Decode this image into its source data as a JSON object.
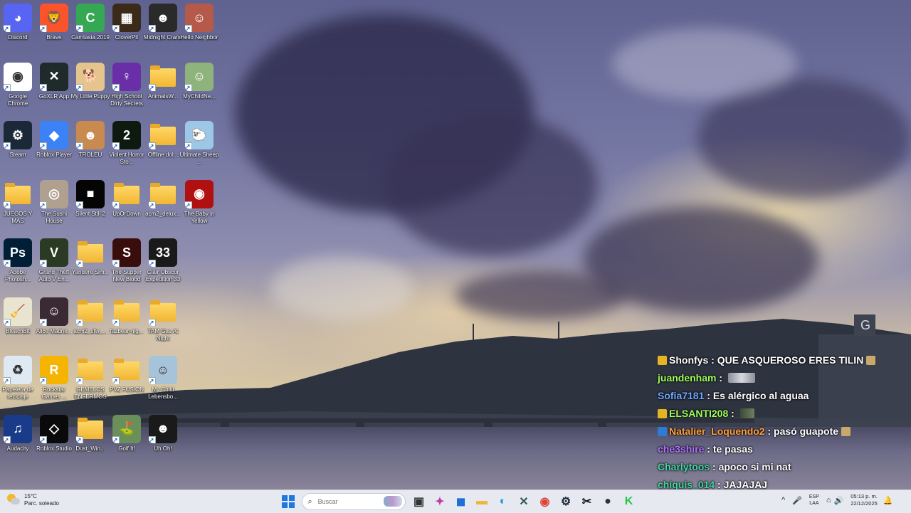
{
  "desktop": {
    "icons": [
      {
        "label": "Discord",
        "icon": "discord-icon",
        "bg": "#5865f2",
        "glyph": "◕"
      },
      {
        "label": "Brave",
        "icon": "brave-icon",
        "bg": "#fb542b",
        "glyph": "🦁"
      },
      {
        "label": "Camtasia 2019",
        "icon": "camtasia-icon",
        "bg": "#34a853",
        "glyph": "C"
      },
      {
        "label": "CloverPit",
        "icon": "cloverpit-icon",
        "bg": "#3a2a1a",
        "glyph": "▦"
      },
      {
        "label": "Midnight Crane",
        "icon": "midnight-crane-icon",
        "bg": "#2a2a2a",
        "glyph": "☻"
      },
      {
        "label": "Hello Neighbor",
        "icon": "hello-neighbor-icon",
        "bg": "#b55a4a",
        "glyph": "☺"
      },
      {
        "label": "Google Chrome",
        "icon": "chrome-icon",
        "bg": "#ffffff",
        "glyph": "◉"
      },
      {
        "label": "GoXLR App",
        "icon": "goxlr-icon",
        "bg": "#1f2b2b",
        "glyph": "✕"
      },
      {
        "label": "My Little Puppy",
        "icon": "puppy-icon",
        "bg": "#e6c48e",
        "glyph": "🐕"
      },
      {
        "label": "High School Dirty Secrets",
        "icon": "high-school-icon",
        "bg": "#6a2fa8",
        "glyph": "♀"
      },
      {
        "label": "AnimalsW...",
        "icon": "folder-icon",
        "folder": true
      },
      {
        "label": "MyChildNe...",
        "icon": "my-child-icon",
        "bg": "#8fb37d",
        "glyph": "☺"
      },
      {
        "label": "Steam",
        "icon": "steam-icon",
        "bg": "#1b2838",
        "glyph": "⚙"
      },
      {
        "label": "Roblox Player",
        "icon": "roblox-icon",
        "bg": "#3b82f6",
        "glyph": "◆"
      },
      {
        "label": "TROLEU",
        "icon": "troleu-icon",
        "bg": "#c88a4e",
        "glyph": "☻"
      },
      {
        "label": "Violent Horror Sto...",
        "icon": "violent-horror-icon",
        "bg": "#0e1a10",
        "glyph": "2"
      },
      {
        "label": "Offline dol...",
        "icon": "folder-icon",
        "folder": true
      },
      {
        "label": "Ultimate Sheep ...",
        "icon": "ultimate-sheep-icon",
        "bg": "#9cc7e6",
        "glyph": "🐑"
      },
      {
        "label": "JUEGOS Y MAS",
        "icon": "folder-icon",
        "folder": true
      },
      {
        "label": "The Sushi House",
        "icon": "sushi-house-icon",
        "bg": "#b0a090",
        "glyph": "◎"
      },
      {
        "label": "Silent Still 2",
        "icon": "silent-still-icon",
        "bg": "#050505",
        "glyph": "■"
      },
      {
        "label": "UpOrDown",
        "icon": "folder-icon",
        "folder": true
      },
      {
        "label": "acm2_delux...",
        "icon": "folder-icon",
        "folder": true
      },
      {
        "label": "The Baby in Yellow",
        "icon": "baby-yellow-icon",
        "bg": "#b01010",
        "glyph": "◉"
      },
      {
        "label": "Adobe Photosh...",
        "icon": "photoshop-icon",
        "bg": "#001e36",
        "glyph": "Ps"
      },
      {
        "label": "Grand Theft Auto V En...",
        "icon": "gta-icon",
        "bg": "#2b3a22",
        "glyph": "V"
      },
      {
        "label": "Yandere Sim...",
        "icon": "folder-icon",
        "folder": true
      },
      {
        "label": "The Supper New Blood",
        "icon": "supper-icon",
        "bg": "#3a0d0d",
        "glyph": "S"
      },
      {
        "label": "Clair Obscur Expedition 33",
        "icon": "clair-obscur-icon",
        "bg": "#1a1a1a",
        "glyph": "33"
      },
      {
        "label": "BleachBit",
        "icon": "bleachbit-icon",
        "bg": "#e9e4d0",
        "glyph": "🧹"
      },
      {
        "label": "Alice Madne...",
        "icon": "alice-icon",
        "bg": "#3a2a33",
        "glyph": "☺"
      },
      {
        "label": "acm2_sfw_...",
        "icon": "folder-icon",
        "folder": true
      },
      {
        "label": "fazbear-nig...",
        "icon": "folder-icon",
        "folder": true
      },
      {
        "label": "TAM Gas At Night",
        "icon": "folder-icon",
        "folder": true
      },
      {
        "label": "Papelera de reciclaje",
        "icon": "recycle-bin-icon",
        "bg": "#dfe9f3",
        "glyph": "♻"
      },
      {
        "label": "Rockstar Games ...",
        "icon": "rockstar-icon",
        "bg": "#f4b400",
        "glyph": "R"
      },
      {
        "label": "GEMELOS ENFERMOS",
        "icon": "folder-icon",
        "folder": true
      },
      {
        "label": "PVZ FUSION",
        "icon": "folder-icon",
        "folder": true
      },
      {
        "label": "My Child Lebensbo...",
        "icon": "my-child-lebensborn-icon",
        "bg": "#a7c3d9",
        "glyph": "☺"
      },
      {
        "label": "Audacity",
        "icon": "audacity-icon",
        "bg": "#1a3a8a",
        "glyph": "♫"
      },
      {
        "label": "Roblox Studio",
        "icon": "roblox-studio-icon",
        "bg": "#0a0a0a",
        "glyph": "◇"
      },
      {
        "label": "Dust_Win...",
        "icon": "folder-icon",
        "folder": true
      },
      {
        "label": "Golf It!",
        "icon": "golf-it-icon",
        "bg": "#6a8f5a",
        "glyph": "⛳"
      },
      {
        "label": "Uh Oh!",
        "icon": "uh-oh-icon",
        "bg": "#1a1a1a",
        "glyph": "☻"
      }
    ]
  },
  "chat": {
    "messages": [
      {
        "user": "Shonfys",
        "user_color": "#ffffff",
        "badge_color": "#e6b422",
        "text": "QUE ASQUEROSO ERES TILIN",
        "emote": "tiny"
      },
      {
        "user": "juandenham",
        "user_color": "#9cff5a",
        "badge_color": "",
        "text": "",
        "emote": "wide"
      },
      {
        "user": "Sofia7181",
        "user_color": "#6fa8ff",
        "badge_color": "",
        "text": "Es alérgico al aguaa",
        "emote": ""
      },
      {
        "user": "ELSANTI208",
        "user_color": "#9cff5a",
        "badge_color": "#e6b422",
        "text": "",
        "emote": "small"
      },
      {
        "user": "Natalier_Loquendo2",
        "user_color": "#ff9f3a",
        "badge_color": "#2e7bd6",
        "text": "pasó guapote",
        "emote": "tiny"
      },
      {
        "user": "che3shire",
        "user_color": "#b074ff",
        "badge_color": "",
        "text": "te pasas",
        "emote": ""
      },
      {
        "user": "Charlytoos",
        "user_color": "#3fd6a0",
        "badge_color": "",
        "text": "apoco si mi nat",
        "emote": ""
      },
      {
        "user": "chiquis_014",
        "user_color": "#3fd6a0",
        "badge_color": "",
        "text": "JAJAJAJ",
        "emote": ""
      }
    ],
    "separator": " : "
  },
  "taskbar": {
    "weather": {
      "temp": "15°C",
      "condition": "Parc. soleado"
    },
    "search_placeholder": "Buscar",
    "apps": [
      {
        "name": "task-view-button",
        "glyph": "▣",
        "color": "#333"
      },
      {
        "name": "copilot-button",
        "glyph": "✦",
        "color": "#c13aa8"
      },
      {
        "name": "store-button",
        "glyph": "◼",
        "color": "#1f6fd6"
      },
      {
        "name": "file-explorer-button",
        "glyph": "▬",
        "color": "#f2b632"
      },
      {
        "name": "edge-button",
        "glyph": "◐",
        "color": "#1a9bd7"
      },
      {
        "name": "goxlr-taskbar-button",
        "glyph": "✕",
        "color": "#2f5a52"
      },
      {
        "name": "chrome-taskbar-button",
        "glyph": "◉",
        "color": "#db4437"
      },
      {
        "name": "steam-taskbar-button",
        "glyph": "⚙",
        "color": "#1b2838"
      },
      {
        "name": "capcut-taskbar-button",
        "glyph": "✂",
        "color": "#111"
      },
      {
        "name": "obs-taskbar-button",
        "glyph": "●",
        "color": "#333"
      },
      {
        "name": "kick-taskbar-button",
        "glyph": "K",
        "color": "#26c44b"
      }
    ],
    "tray": {
      "chevron": "^",
      "mic": "🎤",
      "lang_top": "ESP",
      "lang_bottom": "LAA",
      "network": "⌂",
      "volume": "🔊",
      "time": "05:13 p. m.",
      "date": "22/12/2025",
      "notif": "🔔"
    }
  }
}
